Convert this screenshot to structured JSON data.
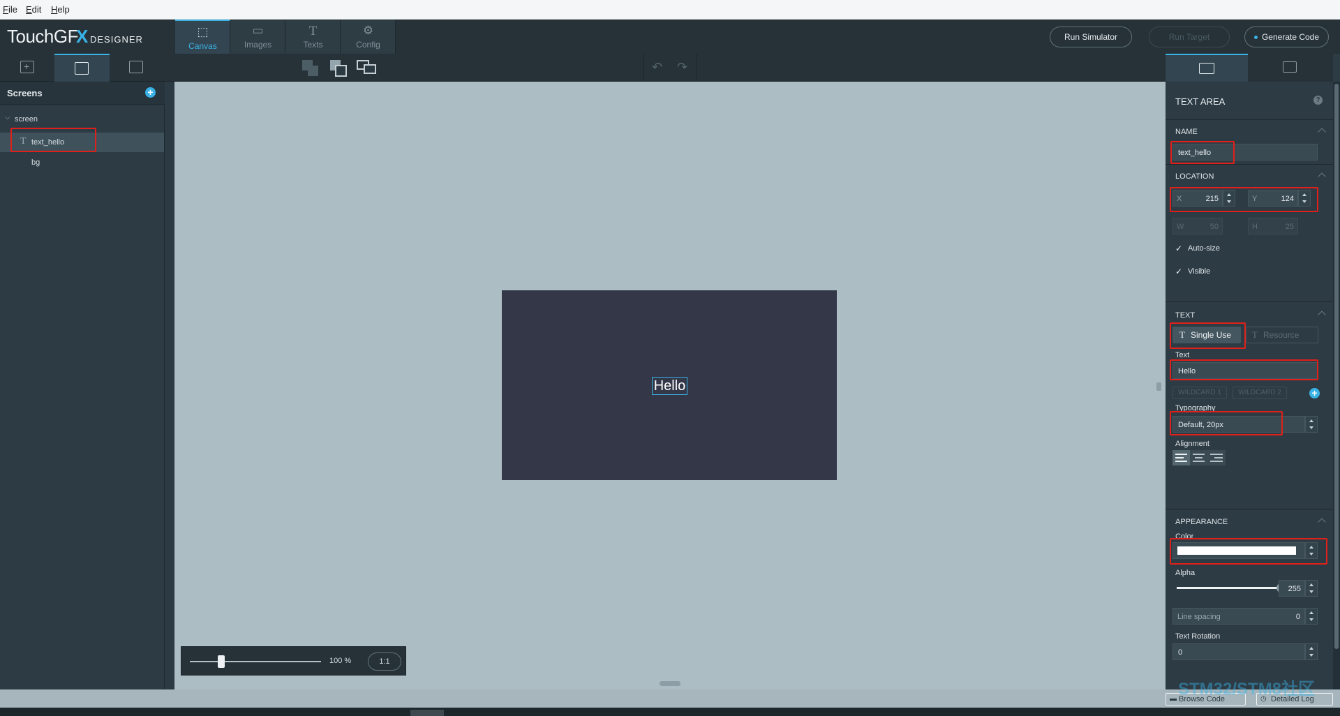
{
  "menu": {
    "file": "File",
    "edit": "Edit",
    "help": "Help"
  },
  "logo": {
    "main": "TouchGF",
    "x": "X",
    "sub": "DESIGNER"
  },
  "top_tabs": [
    {
      "label": "Canvas",
      "icon": "canvas-icon",
      "active": true
    },
    {
      "label": "Images",
      "icon": "images-icon"
    },
    {
      "label": "Texts",
      "icon": "texts-icon"
    },
    {
      "label": "Config",
      "icon": "config-icon"
    }
  ],
  "header_buttons": {
    "run_simulator": "Run Simulator",
    "run_target": "Run Target",
    "generate_code": "Generate Code"
  },
  "left_panel": {
    "title": "Screens",
    "tree": {
      "screen": "screen",
      "text_hello": "text_hello",
      "bg": "bg"
    }
  },
  "canvas": {
    "hello_text": "Hello",
    "screen_color": "#333748",
    "background_color": "#acbdc3",
    "zoom_label": "100 %",
    "zoom_level_fraction": 0.24,
    "zoom_reset": "1:1"
  },
  "properties": {
    "title": "TEXT AREA",
    "help": "?",
    "name": {
      "section": "NAME",
      "value": "text_hello"
    },
    "location": {
      "section": "LOCATION",
      "x_label": "X",
      "x": "215",
      "y_label": "Y",
      "y": "124",
      "w_label": "W",
      "w": "50",
      "h_label": "H",
      "h": "25",
      "auto_size": "Auto-size",
      "visible": "Visible"
    },
    "text": {
      "section": "TEXT",
      "single_use": "Single Use",
      "resource": "Resource",
      "text_label": "Text",
      "text_value": "Hello",
      "wildcard1": "WILDCARD 1",
      "wildcard2": "WILDCARD 2",
      "typography_label": "Typography",
      "typography_value": "Default, 20px",
      "alignment_label": "Alignment"
    },
    "appearance": {
      "section": "APPEARANCE",
      "color_label": "Color",
      "color_value": "#ffffff",
      "alpha_label": "Alpha",
      "alpha_value": "255",
      "line_spacing_label": "Line spacing",
      "line_spacing_value": "0",
      "text_rotation_label": "Text Rotation",
      "text_rotation_value": "0"
    }
  },
  "status": {
    "browse_code": "Browse Code",
    "detailed_log": "Detailed Log"
  },
  "watermark": "STM32/STM8社区",
  "accent_color": "#3ab2e6",
  "highlight_color": "#e0201a"
}
